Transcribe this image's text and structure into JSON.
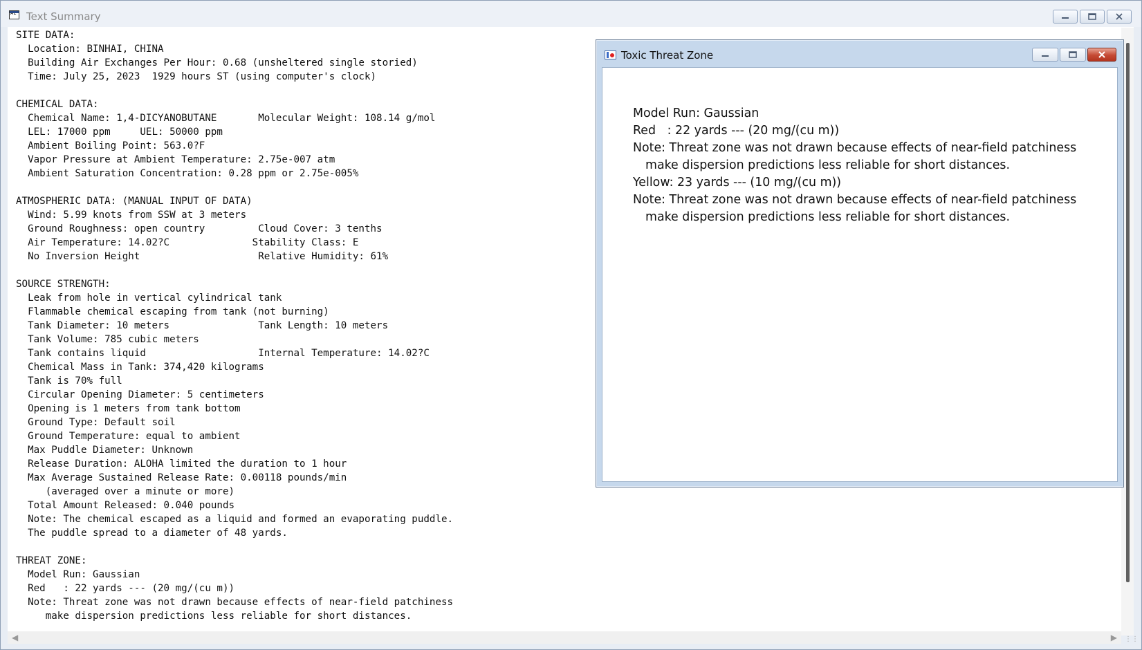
{
  "window": {
    "title": "Text Summary",
    "app_icon": "terminal-icon",
    "icon_label": "AL"
  },
  "report_lines": [
    "SITE DATA:",
    "  Location: BINHAI, CHINA",
    "  Building Air Exchanges Per Hour: 0.68 (unsheltered single storied)",
    "  Time: July 25, 2023  1929 hours ST (using computer's clock)",
    "",
    "CHEMICAL DATA:",
    "  Chemical Name: 1,4-DICYANOBUTANE       Molecular Weight: 108.14 g/mol",
    "  LEL: 17000 ppm     UEL: 50000 ppm",
    "  Ambient Boiling Point: 563.0?F",
    "  Vapor Pressure at Ambient Temperature: 2.75e-007 atm",
    "  Ambient Saturation Concentration: 0.28 ppm or 2.75e-005%",
    "",
    "ATMOSPHERIC DATA: (MANUAL INPUT OF DATA)",
    "  Wind: 5.99 knots from SSW at 3 meters",
    "  Ground Roughness: open country         Cloud Cover: 3 tenths",
    "  Air Temperature: 14.02?C              Stability Class: E",
    "  No Inversion Height                    Relative Humidity: 61%",
    "",
    "SOURCE STRENGTH:",
    "  Leak from hole in vertical cylindrical tank",
    "  Flammable chemical escaping from tank (not burning)",
    "  Tank Diameter: 10 meters               Tank Length: 10 meters",
    "  Tank Volume: 785 cubic meters",
    "  Tank contains liquid                   Internal Temperature: 14.02?C",
    "  Chemical Mass in Tank: 374,420 kilograms",
    "  Tank is 70% full",
    "  Circular Opening Diameter: 5 centimeters",
    "  Opening is 1 meters from tank bottom",
    "  Ground Type: Default soil",
    "  Ground Temperature: equal to ambient",
    "  Max Puddle Diameter: Unknown",
    "  Release Duration: ALOHA limited the duration to 1 hour",
    "  Max Average Sustained Release Rate: 0.00118 pounds/min",
    "     (averaged over a minute or more)",
    "  Total Amount Released: 0.040 pounds",
    "  Note: The chemical escaped as a liquid and formed an evaporating puddle.",
    "  The puddle spread to a diameter of 48 yards.",
    "",
    "THREAT ZONE:",
    "  Model Run: Gaussian",
    "  Red   : 22 yards --- (20 mg/(cu m))",
    "  Note: Threat zone was not drawn because effects of near-field patchiness",
    "     make dispersion predictions less reliable for short distances."
  ],
  "threat_window": {
    "title": "Toxic Threat Zone",
    "icon": "threat-zone-icon",
    "lines": [
      {
        "text": "Model Run: Gaussian",
        "indent": false
      },
      {
        "text": "Red   : 22 yards --- (20 mg/(cu m))",
        "indent": false
      },
      {
        "text": "Note: Threat zone was not drawn because effects of near-field patchiness",
        "indent": false
      },
      {
        "text": "make dispersion predictions less reliable for short distances.",
        "indent": true
      },
      {
        "text": "Yellow: 23 yards --- (10 mg/(cu m))",
        "indent": false
      },
      {
        "text": "Note: Threat zone was not drawn because effects of near-field patchiness",
        "indent": false
      },
      {
        "text": "make dispersion predictions less reliable for short distances.",
        "indent": true
      }
    ]
  },
  "colors": {
    "close_button": "#c54a34",
    "titlebar": "#edf1f7",
    "inner_frame": "#c6d8ec"
  }
}
